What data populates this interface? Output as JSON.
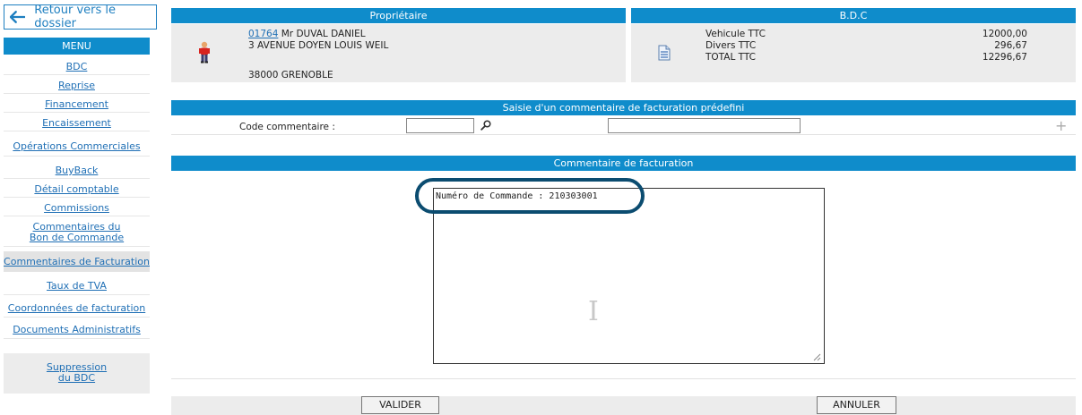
{
  "sidebar": {
    "back_label": "Retour vers le dossier",
    "menu_title": "MENU",
    "items": [
      {
        "label": "BDC"
      },
      {
        "label": "Reprise"
      },
      {
        "label": "Financement"
      },
      {
        "label": "Encaissement"
      },
      {
        "label": "Opérations Commerciales"
      },
      {
        "label": "BuyBack"
      },
      {
        "label": "Détail comptable"
      },
      {
        "label": "Commissions"
      },
      {
        "label": "Commentaires du",
        "label2": "Bon de Commande"
      },
      {
        "label": "Commentaires de Facturation"
      },
      {
        "label": "Taux de TVA"
      },
      {
        "label": "Coordonnées de facturation"
      },
      {
        "label": "Documents Administratifs"
      }
    ],
    "suppression": {
      "line1": "Suppression",
      "line2": "du BDC"
    }
  },
  "owner": {
    "title": "Propriétaire",
    "number": "01764",
    "name": "Mr DUVAL DANIEL",
    "address1": "3 AVENUE DOYEN LOUIS WEIL",
    "city": "38000 GRENOBLE"
  },
  "bdc": {
    "title": "B.D.C",
    "rows": [
      {
        "label": "Vehicule TTC",
        "value": "12000,00"
      },
      {
        "label": "Divers TTC",
        "value": "296,67"
      },
      {
        "label": "TOTAL TTC",
        "value": "12296,67"
      }
    ]
  },
  "predefined": {
    "title": "Saisie d'un commentaire de facturation prédefini",
    "code_label": "Code commentaire :",
    "code_value": "",
    "desc_value": ""
  },
  "comment": {
    "title": "Commentaire de facturation",
    "text": "Numéro de Commande : 210303001"
  },
  "actions": {
    "validate": "VALIDER",
    "cancel": "ANNULER"
  },
  "colors": {
    "header_blue": "#0f8ccb",
    "link_blue": "#1f6fb5",
    "callout": "#0b4c70"
  }
}
